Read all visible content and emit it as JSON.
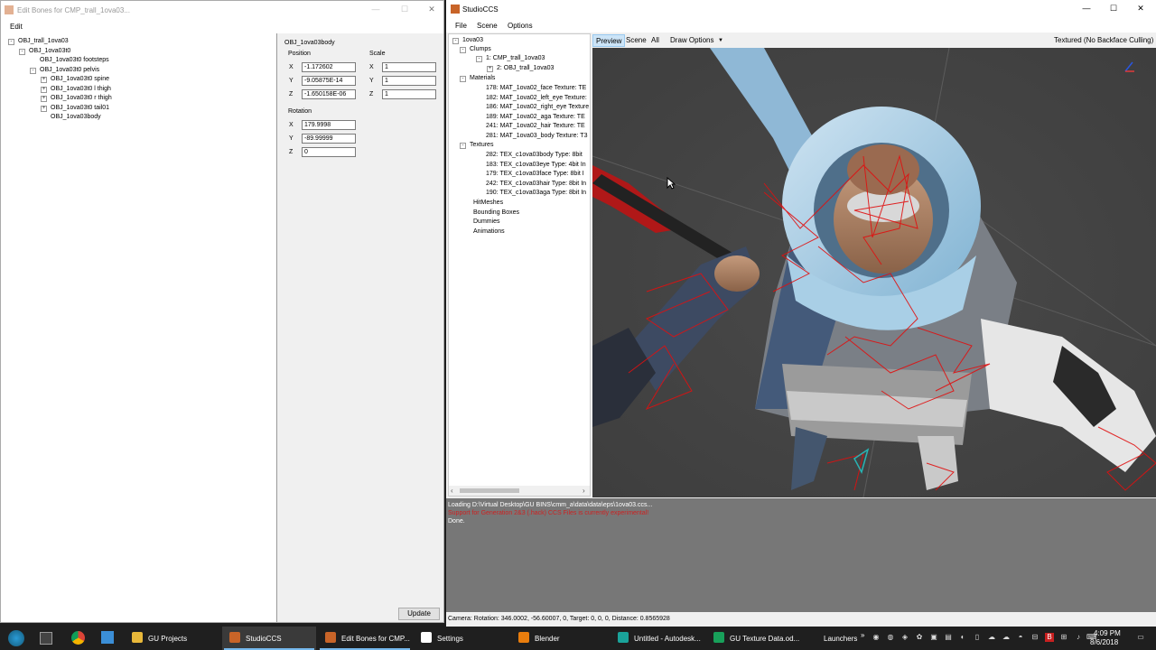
{
  "edit_bones": {
    "title": "Edit Bones for CMP_trall_1ova03...",
    "menu": [
      "Edit"
    ],
    "tree": [
      {
        "label": "OBJ_trall_1ova03",
        "depth": 0,
        "expander": "-"
      },
      {
        "label": "OBJ_1ova03t0",
        "depth": 1,
        "expander": "-"
      },
      {
        "label": "OBJ_1ova03t0 footsteps",
        "depth": 2,
        "expander": ""
      },
      {
        "label": "OBJ_1ova03t0 pelvis",
        "depth": 2,
        "expander": "-"
      },
      {
        "label": "OBJ_1ova03t0 spine",
        "depth": 3,
        "expander": "+"
      },
      {
        "label": "OBJ_1ova03t0 l thigh",
        "depth": 3,
        "expander": "+"
      },
      {
        "label": "OBJ_1ova03t0 r thigh",
        "depth": 3,
        "expander": "+"
      },
      {
        "label": "OBJ_1ova03t0 tail01",
        "depth": 3,
        "expander": "+"
      },
      {
        "label": "OBJ_1ova03body",
        "depth": 3,
        "expander": ""
      }
    ],
    "selected_name": "OBJ_1ova03body",
    "position_label": "Position",
    "scale_label": "Scale",
    "rotation_label": "Rotation",
    "position": {
      "x": "-1.172602",
      "y": "-9.05875E-14",
      "z": "-1.650158E-06"
    },
    "scale": {
      "x": "1",
      "y": "1",
      "z": "1"
    },
    "rotation": {
      "x": "179.9998",
      "y": "-89.99999",
      "z": "0"
    },
    "axis_labels": {
      "x": "X",
      "y": "Y",
      "z": "Z"
    },
    "update_button": "Update"
  },
  "studio": {
    "title": "StudioCCS",
    "menu": [
      "File",
      "Scene",
      "Options"
    ],
    "tree": {
      "root": "1ova03",
      "clumps_label": "Clumps",
      "clump": "1: CMP_trall_1ova03",
      "clump_child": "2: OBJ_trall_1ova03",
      "materials_label": "Materials",
      "materials": [
        "178: MAT_1ova02_face Texture: TE",
        "182: MAT_1ova02_left_eye Texture:",
        "186: MAT_1ova02_right_eye Texture",
        "189: MAT_1ova02_aga Texture: TE",
        "241: MAT_1ova02_hair Texture: TE",
        "281: MAT_1ova03_body Texture: T3"
      ],
      "textures_label": "Textures",
      "textures": [
        "282: TEX_c1ova03body  Type: 8bit",
        "183: TEX_c1ova03eye  Type: 4bit In",
        "179: TEX_c1ova03face  Type: 8bit I",
        "242: TEX_c1ova03hair  Type: 8bit In",
        "190: TEX_c1ova03aga  Type: 8bit In"
      ],
      "others": [
        "HitMeshes",
        "Bounding Boxes",
        "Dummies",
        "Animations"
      ]
    },
    "toolbar": {
      "preview": "Preview",
      "scene": "Scene",
      "all": "All",
      "draw_options": "Draw Options",
      "render_mode": "Textured (No Backface Culling)"
    },
    "console": [
      {
        "text": "Loading D:\\Virtual Desktop\\GU BINS\\cmm_a\\data\\data\\eps\\1ova03.ccs...",
        "color": "#ffffff"
      },
      {
        "text": "Support for Generation 2&3 (.hack) CCS Files is currently experimental!",
        "color": "#cc2222"
      },
      {
        "text": "Done.",
        "color": "#ffffff"
      }
    ],
    "status": "Camera: Rotation: 346.0002, -56.60007, 0, Target: 0, 0, 0, Distance: 0.8565928"
  },
  "taskbar": {
    "items": [
      {
        "label": "GU Projects",
        "icon_color": "#e8b83a",
        "icon": "folder-icon",
        "open": false,
        "active": false
      },
      {
        "label": "StudioCCS",
        "icon_color": "#c86428",
        "icon": "studioccs-icon",
        "open": true,
        "active": true
      },
      {
        "label": "Edit Bones for CMP...",
        "icon_color": "#c86428",
        "icon": "studioccs-icon",
        "open": true,
        "active": false
      },
      {
        "label": "Settings",
        "icon_color": "#ffffff",
        "icon": "gear-icon",
        "open": false,
        "active": false
      },
      {
        "label": "Blender",
        "icon_color": "#e87d0d",
        "icon": "blender-icon",
        "open": false,
        "active": false
      },
      {
        "label": "Untitled - Autodesk...",
        "icon_color": "#1aa39a",
        "icon": "autodesk-icon",
        "open": false,
        "active": false
      },
      {
        "label": "GU Texture Data.od...",
        "icon_color": "#18a05a",
        "icon": "spreadsheet-icon",
        "open": false,
        "active": false
      }
    ],
    "launchers": "Launchers",
    "time": "4:09 PM",
    "date": "8/6/2018"
  },
  "colors": {
    "viewport_bg": "#444444",
    "console_bg": "#777777",
    "taskbar_bg": "#1f1f1f",
    "preview_active": "#cce4f7"
  }
}
